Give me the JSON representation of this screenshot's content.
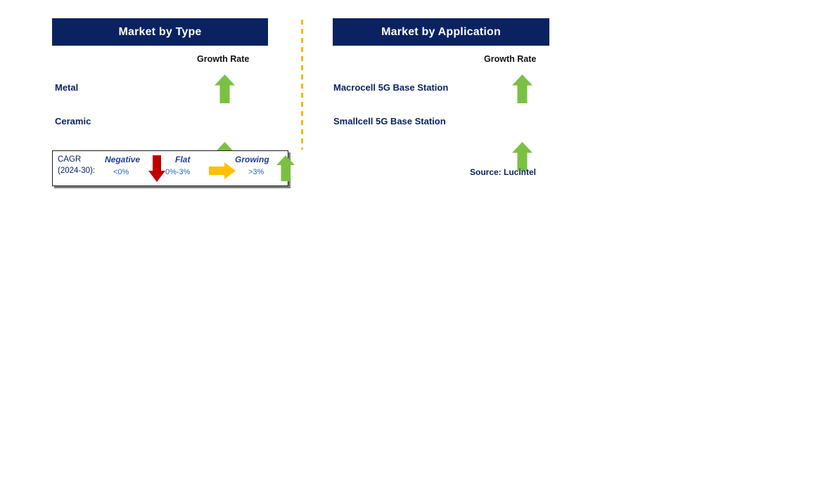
{
  "slide": {
    "source_note": "Source: Lucintel"
  },
  "panels": [
    {
      "id": "type",
      "header": "Market by Type",
      "growth_rate_label": "Growth Rate",
      "segments": [
        {
          "label": "Metal",
          "growth": "growing",
          "icon": "arrow-up-green"
        },
        {
          "label": "Ceramic",
          "growth": "growing",
          "icon": "arrow-up-green"
        }
      ]
    },
    {
      "id": "application",
      "header": "Market by Application",
      "growth_rate_label": "Growth Rate",
      "segments": [
        {
          "label": "Macrocell 5G Base Station",
          "growth": "growing",
          "icon": "arrow-up-green"
        },
        {
          "label": "Smallcell 5G Base Station",
          "growth": "growing",
          "icon": "arrow-up-green"
        }
      ]
    }
  ],
  "legend": {
    "title_line1": "CAGR",
    "title_line2": "(2024-30):",
    "items": [
      {
        "term": "Negative",
        "range": "<0%",
        "icon": "arrow-down-red"
      },
      {
        "term": "Flat",
        "range": "0%-3%",
        "icon": "arrow-right-orange"
      },
      {
        "term": "Growing",
        "range": ">3%",
        "icon": "arrow-up-green"
      }
    ]
  },
  "colors": {
    "header_navy": "#0a2260",
    "growing_green": "#7ac143",
    "negative_red": "#c00000",
    "flat_orange": "#ffc000",
    "divider_orange": "#ffb400",
    "label_navy": "#0a2260"
  }
}
